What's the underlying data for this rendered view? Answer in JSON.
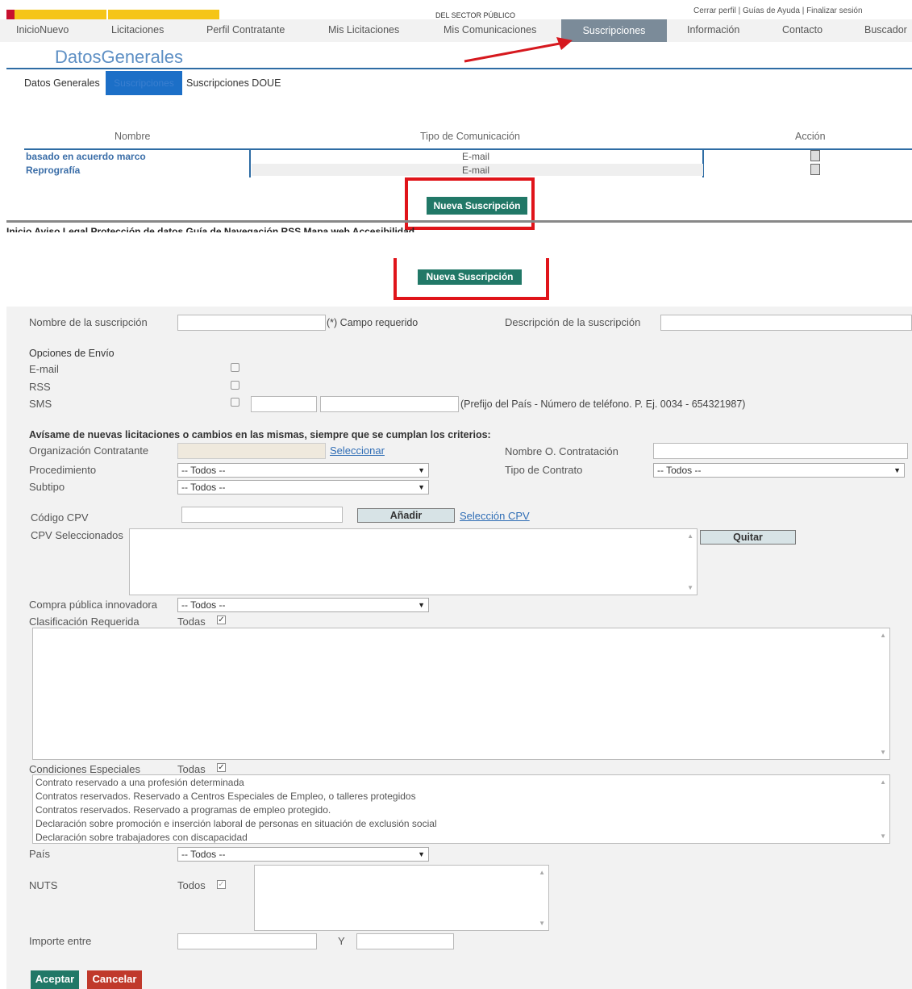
{
  "header": {
    "sector_text": "DEL SECTOR PÚBLICO",
    "top_links": "Cerrar perfil | Guías de Ayuda | Finalizar sesión",
    "nav_items": [
      "InicioNuevo",
      "Licitaciones",
      "Perfil Contratante",
      "Mis Licitaciones",
      "Mis Comunicaciones",
      "Suscripciones",
      "Información",
      "Contacto",
      "Buscador"
    ]
  },
  "page_title": "DatosGenerales",
  "subtabs": [
    "Datos Generales",
    "Suscripciones",
    "Suscripciones DOUE"
  ],
  "table": {
    "headers": [
      "Nombre",
      "Tipo de Comunicación",
      "Acción"
    ],
    "rows": [
      {
        "nombre": "basado en acuerdo marco",
        "tipo": "E-mail"
      },
      {
        "nombre": "Reprografía",
        "tipo": "E-mail"
      }
    ]
  },
  "nueva_suscripcion_label": "Nueva Suscripción",
  "footer_links": "Inicio   Aviso Legal   Protección de datos   Guía de Navegación   RSS   Mapa web   Accesibilidad",
  "form": {
    "nombre_label": "Nombre de la suscripción",
    "campo_requerido": "(*) Campo requerido",
    "descripcion_label": "Descripción de la suscripción",
    "opciones_envio": "Opciones de Envío",
    "email_label": "E-mail",
    "rss_label": "RSS",
    "sms_label": "SMS",
    "sms_hint": "(Prefijo del País - Número de teléfono. P. Ej. 0034 - 654321987)",
    "avisame": "Avísame de nuevas licitaciones o cambios en las mismas, siempre que se cumplan los criterios:",
    "org_label": "Organización Contratante",
    "seleccionar": "Seleccionar",
    "nombre_org_label": "Nombre O. Contratación",
    "procedimiento_label": "Procedimiento",
    "tipo_contrato_label": "Tipo de Contrato",
    "subtipo_label": "Subtipo",
    "todos": "-- Todos --",
    "cpv_label": "Código CPV",
    "anadir": "Añadir",
    "seleccion_cpv": "Selección CPV",
    "cpv_sel_label": "CPV Seleccionados",
    "quitar": "Quitar",
    "compra_label": "Compra pública innovadora",
    "clasificacion_label": "Clasificación Requerida",
    "todas": "Todas",
    "condiciones_label": "Condiciones Especiales",
    "condiciones": [
      "Contrato reservado a una profesión determinada",
      "Contratos reservados. Reservado a Centros Especiales de Empleo, o talleres protegidos",
      "Contratos reservados. Reservado a programas de empleo protegido.",
      "Declaración sobre promoción e inserción laboral de personas en situación de exclusión social",
      "Declaración sobre trabajadores con discapacidad"
    ],
    "pais_label": "País",
    "nuts_label": "NUTS",
    "todos_plain": "Todos",
    "importe_label": "Importe entre",
    "y_label": "Y",
    "aceptar": "Aceptar",
    "cancelar": "Cancelar"
  }
}
